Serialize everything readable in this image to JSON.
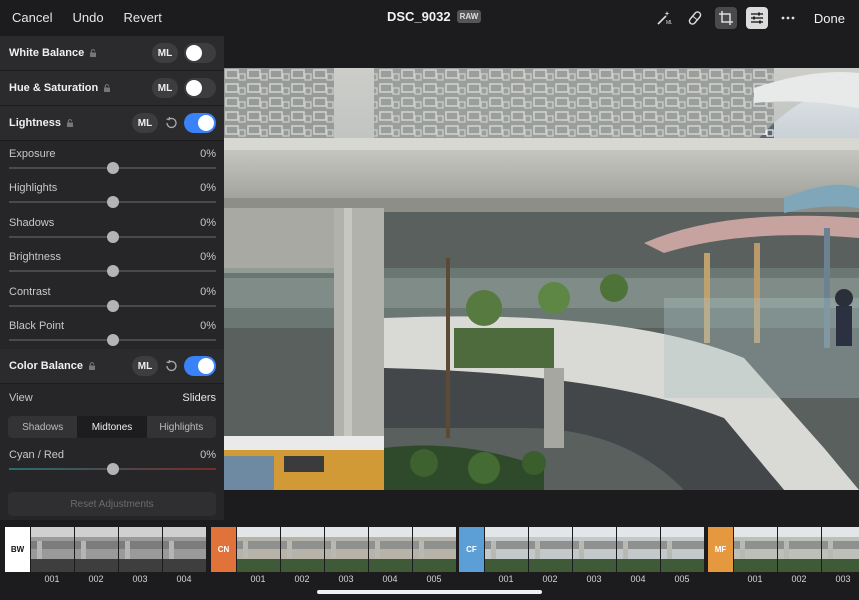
{
  "topbar": {
    "cancel": "Cancel",
    "undo": "Undo",
    "revert": "Revert",
    "filename": "DSC_9032",
    "badge": "RAW",
    "done": "Done",
    "icons": [
      "magic-wand-icon",
      "healing-brush-icon",
      "crop-icon",
      "adjustments-icon",
      "more-icon"
    ]
  },
  "panel": {
    "white_balance": {
      "title": "White Balance",
      "ml": "ML",
      "enabled": false
    },
    "hue_saturation": {
      "title": "Hue & Saturation",
      "ml": "ML",
      "enabled": false
    },
    "lightness": {
      "title": "Lightness",
      "ml": "ML",
      "enabled": true,
      "sliders": [
        {
          "label": "Exposure",
          "value": "0%",
          "position": 0.5
        },
        {
          "label": "Highlights",
          "value": "0%",
          "position": 0.5
        },
        {
          "label": "Shadows",
          "value": "0%",
          "position": 0.5
        },
        {
          "label": "Brightness",
          "value": "0%",
          "position": 0.5
        },
        {
          "label": "Contrast",
          "value": "0%",
          "position": 0.5
        },
        {
          "label": "Black Point",
          "value": "0%",
          "position": 0.5
        }
      ]
    },
    "color_balance": {
      "title": "Color Balance",
      "ml": "ML",
      "enabled": true,
      "view_label": "View",
      "view_value": "Sliders",
      "segments": [
        "Shadows",
        "Midtones",
        "Highlights"
      ],
      "selected_segment": 1,
      "cyan_red": {
        "label": "Cyan / Red",
        "value": "0%",
        "position": 0.5
      }
    },
    "reset_label": "Reset Adjustments"
  },
  "filmstrip": {
    "groups": [
      {
        "tag": "BW",
        "color": "#ffffff",
        "tag_text_color": "#111111",
        "items": [
          "001",
          "002",
          "003",
          "004"
        ]
      },
      {
        "tag": "CN",
        "color": "#e0723a",
        "tag_text_color": "#ffffff",
        "items": [
          "001",
          "002",
          "003",
          "004",
          "005"
        ]
      },
      {
        "tag": "CF",
        "color": "#5c9fd6",
        "tag_text_color": "#ffffff",
        "items": [
          "001",
          "002",
          "003",
          "004",
          "005"
        ]
      },
      {
        "tag": "MF",
        "color": "#e6983e",
        "tag_text_color": "#ffffff",
        "items": [
          "001",
          "002",
          "003"
        ]
      }
    ]
  },
  "colors": {
    "accent": "#3a82f7",
    "panel": "#262628",
    "background": "#1c1c1e"
  }
}
